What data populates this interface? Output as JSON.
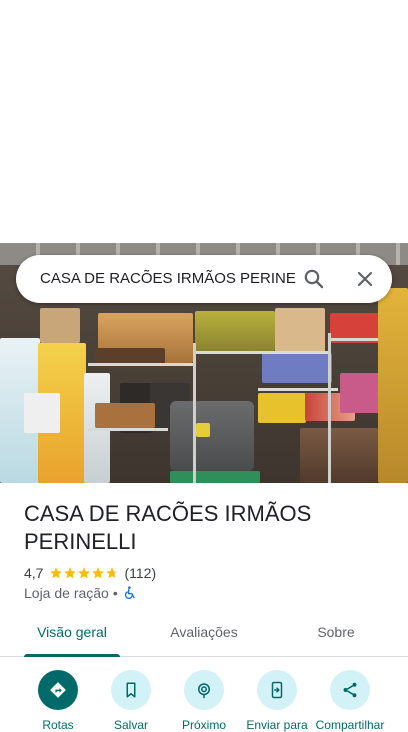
{
  "search": {
    "query": "CASA DE RACÕES IRMÃOS PERINEL"
  },
  "place": {
    "name": "CASA DE RACÕES IRMÃOS PERINELLI",
    "rating": "4,7",
    "rating_value": 4.7,
    "review_count": "(112)",
    "category": "Loja de ração",
    "separator": "•"
  },
  "tabs": [
    {
      "label": "Visão geral",
      "active": true
    },
    {
      "label": "Avaliações",
      "active": false
    },
    {
      "label": "Sobre",
      "active": false
    }
  ],
  "actions": [
    {
      "label": "Rotas",
      "icon": "directions-icon"
    },
    {
      "label": "Salvar",
      "icon": "bookmark-icon"
    },
    {
      "label": "Próximo",
      "icon": "nearby-icon"
    },
    {
      "label": "Enviar para",
      "icon": "send-to-phone-icon"
    },
    {
      "label": "Compartilhar",
      "icon": "share-icon"
    }
  ],
  "colors": {
    "accent": "#006a6a",
    "action_bg": "#d2f2f7",
    "star": "#fbbc04",
    "accessibility": "#1a73e8"
  }
}
